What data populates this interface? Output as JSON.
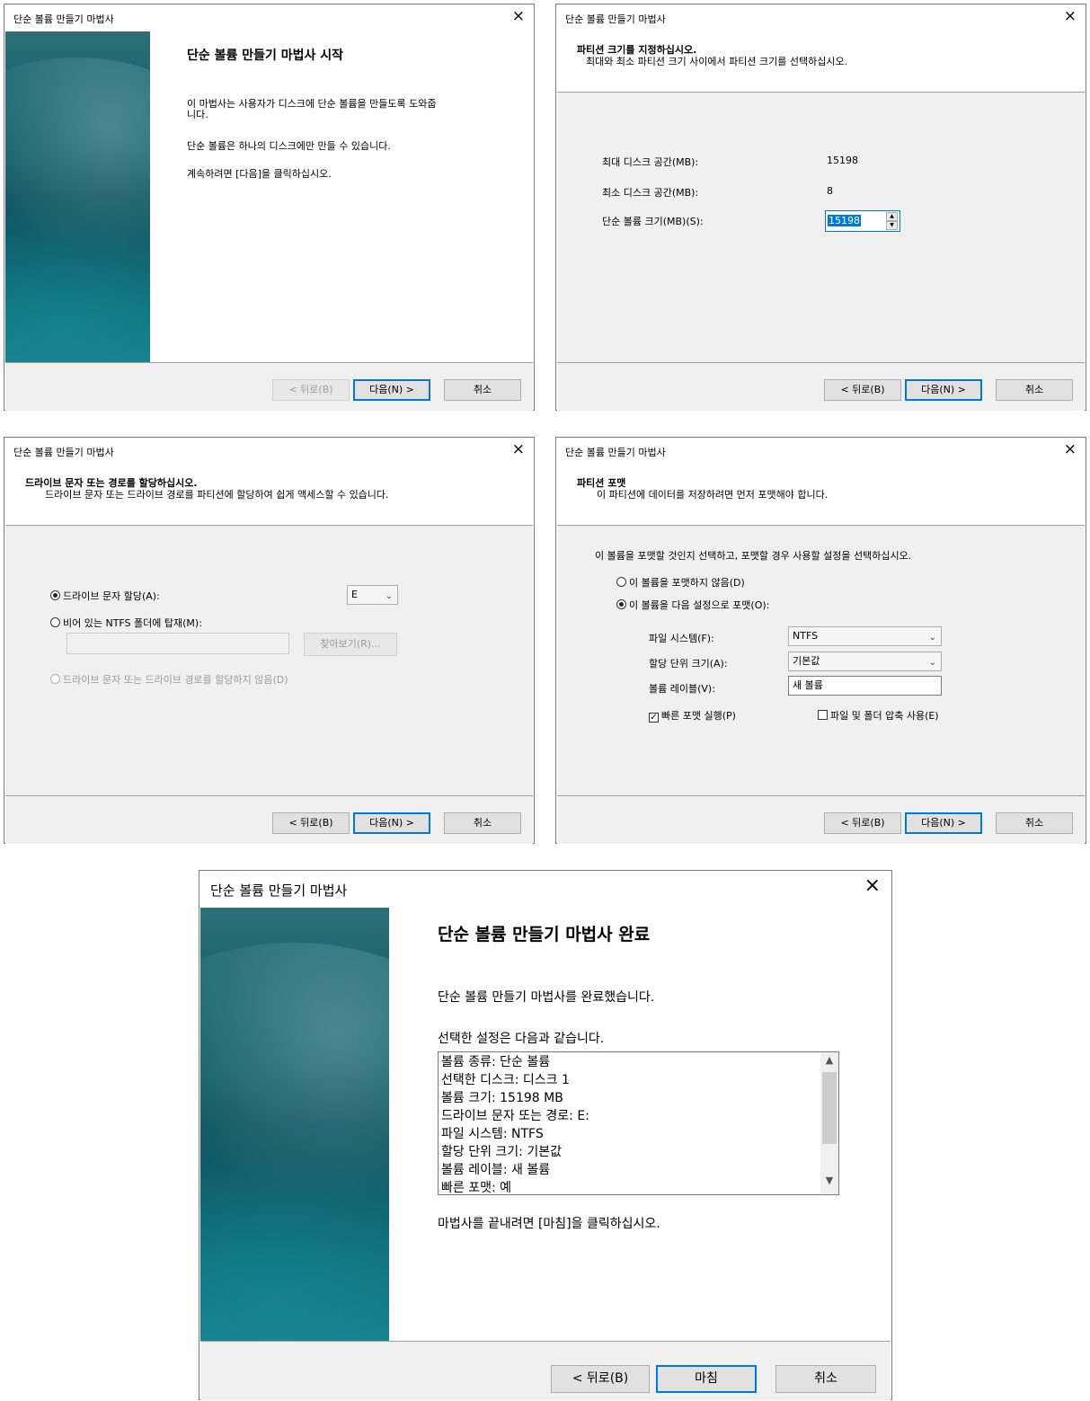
{
  "dialog1": {
    "title": "단순 볼륨 만들기 마법사",
    "heading": "단순 볼륨 만들기 마법사 시작",
    "para1": "이 마법사는 사용자가 디스크에 단순 볼륨을 만들도록 도와줍",
    "para1b": "니다.",
    "para2": "단순 볼륨은 하나의 디스크에만 만들 수 있습니다.",
    "para3": "계속하려면 [다음]을 클릭하십시오.",
    "back": "< 뒤로(B)",
    "next": "다음(N) >",
    "cancel": "취소"
  },
  "dialog2": {
    "title": "단순 볼륨 만들기 마법사",
    "header_title": "파티션 크기를 지정하십시오.",
    "header_sub": "최대와 최소 파티션 크기 사이에서 파티션 크기를 선택하십시오.",
    "max_label": "최대 디스크 공간(MB):",
    "max_value": "15198",
    "min_label": "최소 디스크 공간(MB):",
    "min_value": "8",
    "size_label": "단순 볼륨 크기(MB)(S):",
    "size_value": "15198",
    "back": "< 뒤로(B)",
    "next": "다음(N) >",
    "cancel": "취소"
  },
  "dialog3": {
    "title": "단순 볼륨 만들기 마법사",
    "header_title": "드라이브 문자 또는 경로를 할당하십시오.",
    "header_sub": "드라이브 문자 또는 드라이브 경로를 파티션에 할당하여 쉽게 액세스할 수 있습니다.",
    "opt_assign": "드라이브 문자 할당(A):",
    "drive_letter": "E",
    "opt_mount": "비어 있는 NTFS 폴더에 탑재(M):",
    "browse": "찾아보기(R)...",
    "opt_none": "드라이브 문자 또는 드라이브 경로를 할당하지 않음(D)",
    "back": "< 뒤로(B)",
    "next": "다음(N) >",
    "cancel": "취소"
  },
  "dialog4": {
    "title": "단순 볼륨 만들기 마법사",
    "header_title": "파티션 포맷",
    "header_sub": "이 파티션에 데이터를 저장하려면 먼저 포맷해야 합니다.",
    "intro": "이 볼륨을 포맷할 것인지 선택하고, 포맷할 경우 사용할 설정을 선택하십시오.",
    "opt_noformat": "이 볼륨을 포맷하지 않음(D)",
    "opt_format": "이 볼륨을 다음 설정으로 포맷(O):",
    "fs_label": "파일 시스템(F):",
    "fs_value": "NTFS",
    "alloc_label": "할당 단위 크기(A):",
    "alloc_value": "기본값",
    "vol_label": "볼륨 레이블(V):",
    "vol_value": "새 볼륨",
    "quick": "빠른 포맷 실행(P)",
    "compress": "파일 및 폴더 압축 사용(E)",
    "back": "< 뒤로(B)",
    "next": "다음(N) >",
    "cancel": "취소"
  },
  "dialog5": {
    "title": "단순 볼륨 만들기 마법사",
    "heading": "단순 볼륨 만들기 마법사 완료",
    "para1": "단순 볼륨 만들기 마법사를 완료했습니다.",
    "para2": "선택한 설정은 다음과 같습니다.",
    "summary": [
      "볼륨 종류: 단순 볼륨",
      "선택한 디스크: 디스크 1",
      "볼륨 크기: 15198 MB",
      "드라이브 문자 또는 경로: E:",
      "파일 시스템: NTFS",
      "할당 단위 크기: 기본값",
      "볼륨 레이블: 새 볼륨",
      "빠른 포맷: 예"
    ],
    "para3": "마법사를 끝내려면 [마침]을 클릭하십시오.",
    "back": "< 뒤로(B)",
    "finish": "마침",
    "cancel": "취소"
  },
  "icons": {
    "close": "×",
    "chevron": "⌄",
    "up": "▲",
    "down": "▼",
    "check": "✓"
  },
  "colors": {
    "accent": "#0078d7",
    "banner": "#0b4f5c",
    "panel": "#f0f0f0"
  }
}
